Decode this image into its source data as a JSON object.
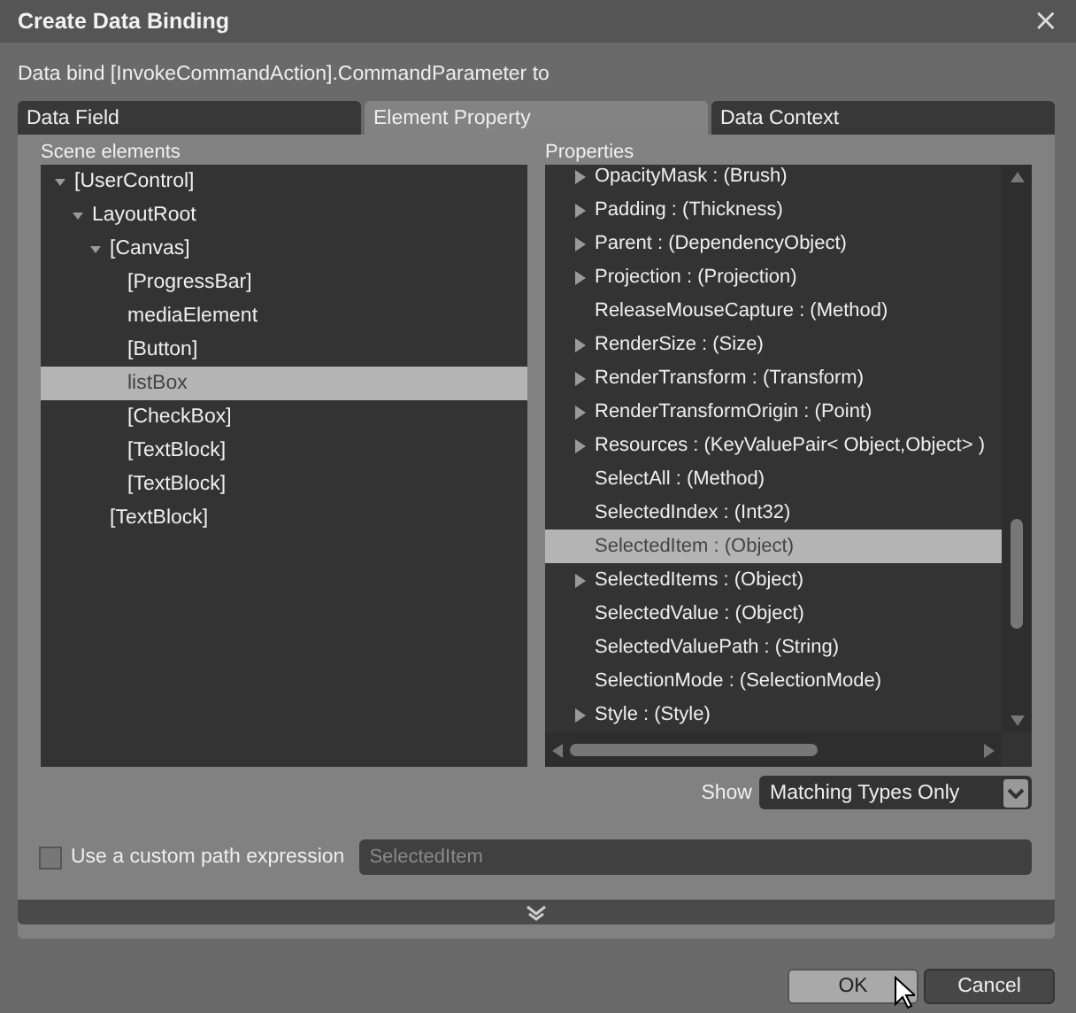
{
  "window": {
    "title": "Create Data Binding",
    "close": "×"
  },
  "subtitle": "Data bind [InvokeCommandAction].CommandParameter to",
  "tabs": [
    {
      "label": "Data Field",
      "selected": false
    },
    {
      "label": "Element Property",
      "selected": true
    },
    {
      "label": "Data Context",
      "selected": false
    }
  ],
  "scene_elements": {
    "label": "Scene elements",
    "items": [
      {
        "label": "[UserControl]",
        "selected": false,
        "expanded": true,
        "children": [
          {
            "label": "LayoutRoot",
            "selected": false,
            "expanded": true,
            "children": [
              {
                "label": "[Canvas]",
                "selected": false,
                "expanded": true,
                "children": [
                  {
                    "label": "[ProgressBar]",
                    "selected": false
                  },
                  {
                    "label": "mediaElement",
                    "selected": false
                  },
                  {
                    "label": "[Button]",
                    "selected": false
                  },
                  {
                    "label": "listBox",
                    "selected": true
                  },
                  {
                    "label": "[CheckBox]",
                    "selected": false
                  },
                  {
                    "label": "[TextBlock]",
                    "selected": false
                  },
                  {
                    "label": "[TextBlock]",
                    "selected": false
                  }
                ]
              },
              {
                "label": "[TextBlock]",
                "selected": false
              }
            ]
          }
        ]
      }
    ]
  },
  "properties": {
    "label": "Properties",
    "items": [
      {
        "label": "OpacityMask : (Brush)",
        "expandable": true,
        "selected": false
      },
      {
        "label": "Padding : (Thickness)",
        "expandable": true,
        "selected": false
      },
      {
        "label": "Parent : (DependencyObject)",
        "expandable": true,
        "selected": false
      },
      {
        "label": "Projection : (Projection)",
        "expandable": true,
        "selected": false
      },
      {
        "label": "ReleaseMouseCapture : (Method)",
        "expandable": false,
        "selected": false
      },
      {
        "label": "RenderSize : (Size)",
        "expandable": true,
        "selected": false
      },
      {
        "label": "RenderTransform : (Transform)",
        "expandable": true,
        "selected": false
      },
      {
        "label": "RenderTransformOrigin : (Point)",
        "expandable": true,
        "selected": false
      },
      {
        "label": "Resources : (KeyValuePair< Object,Object> )",
        "expandable": true,
        "selected": false
      },
      {
        "label": "SelectAll : (Method)",
        "expandable": false,
        "selected": false
      },
      {
        "label": "SelectedIndex : (Int32)",
        "expandable": false,
        "selected": false
      },
      {
        "label": "SelectedItem : (Object)",
        "expandable": false,
        "selected": true
      },
      {
        "label": "SelectedItems : (Object)",
        "expandable": true,
        "selected": false
      },
      {
        "label": "SelectedValue : (Object)",
        "expandable": false,
        "selected": false
      },
      {
        "label": "SelectedValuePath : (String)",
        "expandable": false,
        "selected": false
      },
      {
        "label": "SelectionMode : (SelectionMode)",
        "expandable": false,
        "selected": false
      },
      {
        "label": "Style : (Style)",
        "expandable": true,
        "selected": false
      }
    ]
  },
  "show": {
    "label": "Show",
    "value": "Matching Types Only"
  },
  "custom_path": {
    "label": "Use a custom path expression",
    "checked": false,
    "placeholder": "SelectedItem"
  },
  "buttons": [
    {
      "label": "OK",
      "kind": "default"
    },
    {
      "label": "Cancel",
      "kind": "normal"
    }
  ]
}
